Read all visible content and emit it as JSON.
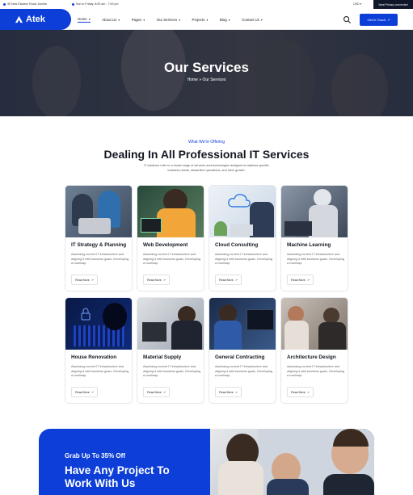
{
  "topbar": {
    "address": "45 New Eskaton Road, Austria",
    "hours": "Sun to Friday: 8:00 am - 7:00 pm",
    "currency": "USD",
    "connection": "Ideal Privacy connected"
  },
  "header": {
    "logo": "Atek",
    "nav": [
      {
        "label": "Home"
      },
      {
        "label": "About Us"
      },
      {
        "label": "Pages"
      },
      {
        "label": "Our Services"
      },
      {
        "label": "Projects"
      },
      {
        "label": "Blog"
      },
      {
        "label": "Contact Us"
      }
    ],
    "cta": "Get In Touch"
  },
  "hero": {
    "title": "Our Services",
    "breadcrumb_home": "Home",
    "breadcrumb_sep": "»",
    "breadcrumb_current": "Our Services"
  },
  "section": {
    "kicker": "What We're Offering",
    "title": "Dealing In All Professional IT Services",
    "description": "IT solutions refer to a broad range of services and technologies designed to address specific business needs, streamline operations, and drive growth."
  },
  "cards": [
    {
      "title": "IT Strategy & Planning",
      "desc": "Assessing current IT infrastructure and aligning it with business goals. Developing a roadmap.",
      "button": "Read More"
    },
    {
      "title": "Web Development",
      "desc": "Assessing current IT infrastructure and aligning it with business goals. Developing a roadmap.",
      "button": "Read More"
    },
    {
      "title": "Cloud Consulting",
      "desc": "Assessing current IT infrastructure and aligning it with business goals. Developing a roadmap.",
      "button": "Read More"
    },
    {
      "title": "Machine Learning",
      "desc": "Assessing current IT infrastructure and aligning it with business goals. Developing a roadmap.",
      "button": "Read More"
    },
    {
      "title": "House Renovation",
      "desc": "Assessing current IT infrastructure and aligning it with business goals. Developing a roadmap.",
      "button": "Read More"
    },
    {
      "title": "Material Supply",
      "desc": "Assessing current IT infrastructure and aligning it with business goals. Developing a roadmap.",
      "button": "Read More"
    },
    {
      "title": "General Contracting",
      "desc": "Assessing current IT infrastructure and aligning it with business goals. Developing a roadmap.",
      "button": "Read More"
    },
    {
      "title": "Architecture Design",
      "desc": "Assessing current IT infrastructure and aligning it with business goals. Developing a roadmap.",
      "button": "Read More"
    }
  ],
  "promo": {
    "kicker": "Grab Up To 35% Off",
    "headline": "Have Any Project To Work With Us"
  },
  "colors": {
    "primary": "#0d3fd8",
    "dark": "#10172a"
  }
}
